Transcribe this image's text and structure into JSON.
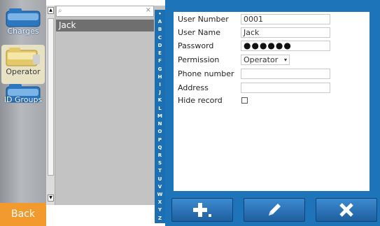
{
  "nav": {
    "items": [
      {
        "label": "Charges",
        "icon": "folder-icon"
      },
      {
        "label": "Operator",
        "icon": "folder-icon"
      },
      {
        "label": "ID Groups",
        "icon": "folder-icon"
      }
    ],
    "back_label": "Back"
  },
  "list": {
    "search_value": "",
    "selected_name": "Jack",
    "alphabet": [
      "•",
      "A",
      "B",
      "C",
      "D",
      "E",
      "F",
      "G",
      "H",
      "I",
      "J",
      "K",
      "L",
      "M",
      "N",
      "O",
      "P",
      "Q",
      "R",
      "S",
      "T",
      "U",
      "V",
      "W",
      "X",
      "Y",
      "Z"
    ]
  },
  "form": {
    "user_number_label": "User Number",
    "user_number": "0001",
    "user_name_label": "User Name",
    "user_name": "Jack",
    "password_label": "Password",
    "password_mask": "●●●●●●",
    "permission_label": "Permission",
    "permission_value": "Operator",
    "phone_label": "Phone number",
    "phone_value": "",
    "address_label": "Address",
    "address_value": "",
    "hide_label": "Hide record",
    "hide_checked": false
  },
  "toolbar": {
    "add_icon": "plus-icon",
    "edit_icon": "pencil-icon",
    "delete_icon": "x-icon"
  },
  "colors": {
    "accent_blue": "#1d74b8",
    "back_orange": "#f29a2e",
    "selected_row": "#6f6f6f"
  }
}
